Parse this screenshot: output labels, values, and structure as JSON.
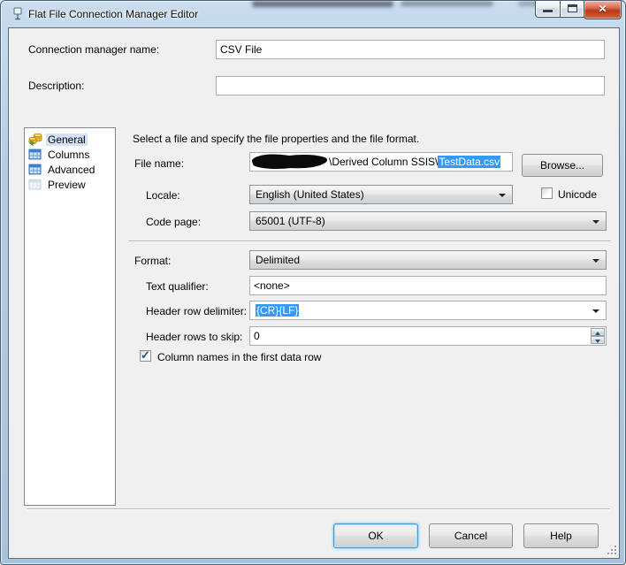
{
  "window": {
    "title": "Flat File Connection Manager Editor"
  },
  "icons": {
    "close-icon": "✕",
    "minimize-icon": "—",
    "maximize-icon": "▢",
    "dropdown-arrow-icon": "▼",
    "spinner-up-icon": "▲",
    "spinner-down-icon": "▼",
    "checkmark-icon": "✓",
    "resize-grip-icon": "⋰",
    "sidebar": [
      "connection-manager-icon",
      "table-icon",
      "table-icon",
      "table-muted-icon"
    ]
  },
  "colors": {
    "selection_blue": "#3399ff",
    "client_bg": "#f0f0f0",
    "titlebar_tint": "#b5cde4",
    "close_button_red": "#bc3515"
  },
  "header": {
    "name_label": "Connection manager name:",
    "name_value": "CSV File",
    "description_label": "Description:",
    "description_value": ""
  },
  "sidebar": {
    "items": [
      {
        "label": "General",
        "selected": true
      },
      {
        "label": "Columns",
        "selected": false
      },
      {
        "label": "Advanced",
        "selected": false
      },
      {
        "label": "Preview",
        "selected": false
      }
    ]
  },
  "main": {
    "intro": "Select a file and specify the file properties and the file format.",
    "file_name": {
      "label": "File name:",
      "redacted": true,
      "visible_path": "\\Derived Column SSIS\\",
      "selected_file": "TestData.csv"
    },
    "browse_label": "Browse...",
    "locale": {
      "label": "Locale:",
      "value": "English (United States)"
    },
    "unicode_label": "Unicode",
    "unicode_checked": false,
    "code_page": {
      "label": "Code page:",
      "value": "65001 (UTF-8)"
    },
    "format": {
      "label": "Format:",
      "value": "Delimited"
    },
    "text_qualifier": {
      "label": "Text qualifier:",
      "value": "<none>"
    },
    "header_row_delimiter": {
      "label": "Header row delimiter:",
      "value": "{CR}{LF}",
      "value_selected": true
    },
    "header_rows_to_skip": {
      "label": "Header rows to skip:",
      "value": "0"
    },
    "column_names_label": "Column names in the first data row",
    "column_names_checked": true
  },
  "footer": {
    "ok": "OK",
    "cancel": "Cancel",
    "help": "Help"
  }
}
